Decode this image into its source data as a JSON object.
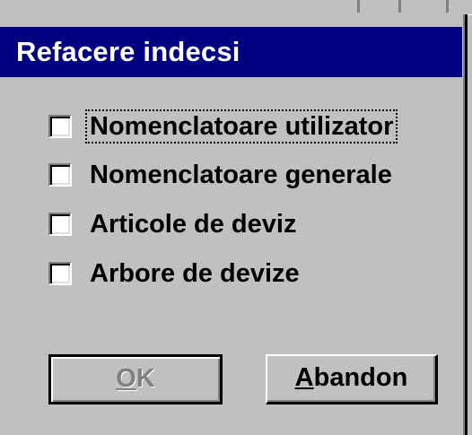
{
  "window": {
    "title": "Refacere indecsi"
  },
  "options": [
    {
      "label": "Nomenclatoare utilizator",
      "checked": false,
      "focused": true
    },
    {
      "label": "Nomenclatoare generale",
      "checked": false,
      "focused": false
    },
    {
      "label": "Articole de deviz",
      "checked": false,
      "focused": false
    },
    {
      "label": "Arbore de devize",
      "checked": false,
      "focused": false
    }
  ],
  "buttons": {
    "ok": {
      "mnemonic": "O",
      "rest": "K",
      "enabled": false
    },
    "abandon": {
      "mnemonic": "A",
      "rest": "bandon",
      "enabled": true
    }
  },
  "colors": {
    "titlebar": "#000080",
    "face": "#c0c0c0",
    "disabled_text": "#808080"
  }
}
